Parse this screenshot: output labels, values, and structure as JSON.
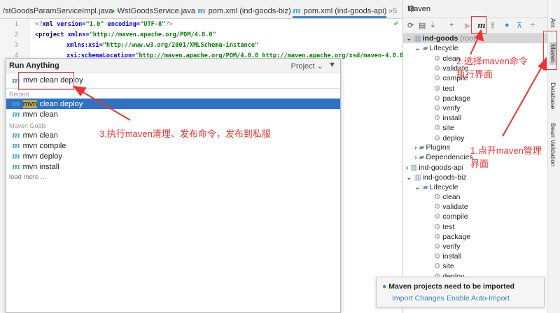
{
  "tabs": [
    "/stGoodsParamServiceImpl.java",
    "WstGoodsService.java",
    "pom.xml (ind-goods-biz)",
    "pom.xml (ind-goods-api)"
  ],
  "tab_more": "»5",
  "code": {
    "lines": [
      "1",
      "2",
      "3",
      "4"
    ],
    "l1": [
      "<?",
      "xml",
      " version=",
      "\"1.0\"",
      " encoding=",
      "\"UTF-8\"",
      "?>"
    ],
    "l2": [
      "<project",
      " xmlns=",
      "\"http://maven.apache.org/POM/4.0.0\""
    ],
    "l3": [
      "xmlns:xsi=",
      "\"http://www.w3.org/2001/XMLSchema-instance\""
    ],
    "l4": [
      "xsi:schemaLocation=",
      "\"http://maven.apache.org/POM/4.0.0 http://maven.apache.org/xsd/maven-4.0.0"
    ]
  },
  "run": {
    "title": "Run Anything",
    "scope": "Project ⌄",
    "input": "mvn clean deploy",
    "recent_label": "Recent",
    "recent": [
      {
        "hl": "mvn",
        "rest": " clean deploy"
      },
      {
        "hl": "",
        "rest": "mvn clean"
      }
    ],
    "goals_label": "Maven Goals",
    "goals": [
      "mvn clean",
      "mvn compile",
      "mvn deploy",
      "mvn install"
    ],
    "load_more": "load more ..."
  },
  "maven": {
    "title": "Maven",
    "root": "ind-goods",
    "root_suffix": " (root)",
    "lifecycle": "Lifecycle",
    "phases": [
      "clean",
      "validate",
      "compile",
      "test",
      "package",
      "verify",
      "install",
      "site",
      "deploy"
    ],
    "plugins": "Plugins",
    "dependencies": "Dependencies",
    "api": "ind-goods-api",
    "biz": "ind-goods-biz"
  },
  "strip": [
    "Ant",
    "Maven",
    "Database",
    "Bean Validation"
  ],
  "notification": {
    "text": "Maven projects need to be imported",
    "import": "Import Changes",
    "auto": "Enable Auto-Import"
  },
  "annotations": {
    "a1": [
      "1.点开maven管理",
      "界面"
    ],
    "a2": [
      "2.选择maven命令",
      "执行界面"
    ],
    "a3": "3.执行maven清理、发布命令，发布到私服"
  },
  "colors": {
    "accent": "#2f72c4",
    "annotation": "#f03030"
  }
}
